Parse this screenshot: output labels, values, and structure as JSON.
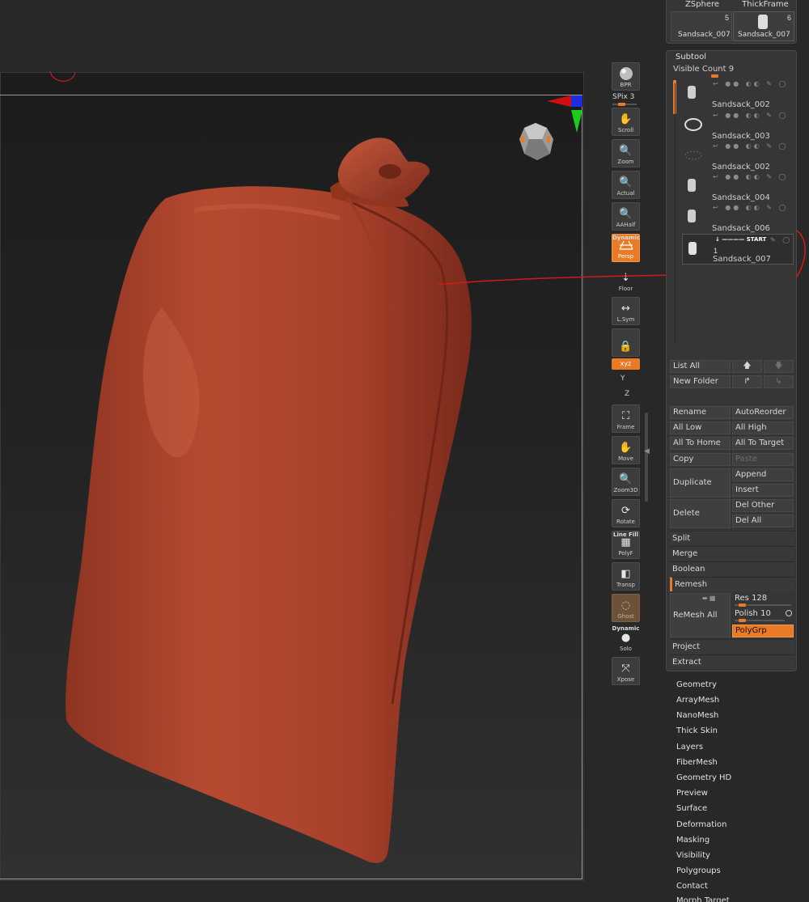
{
  "top_tools": [
    {
      "label": "ZSphere"
    },
    {
      "label": "ThickFrame"
    },
    {
      "label": "Sandsack_007",
      "count": "5"
    },
    {
      "label": "Sandsack_007",
      "count": "6"
    }
  ],
  "shelf": {
    "bpr": "BPR",
    "spix": "SPix 3",
    "buttons": [
      "Scroll",
      "Zoom",
      "Actual",
      "AAHalf",
      "Persp",
      "Floor",
      "L.Sym",
      "",
      "xyz",
      "Frame",
      "Move",
      "Zoom3D",
      "Rotate",
      "PolyF",
      "Transp",
      "Ghost",
      "Solo",
      "Xpose"
    ],
    "persp_tag": "Dynamic",
    "polyf_tag": "Line Fill",
    "solo_tag": "Dynamic",
    "axis_y": "Y",
    "axis_z": "Z"
  },
  "subtool": {
    "title": "Subtool",
    "visible_count_label": "Visible Count",
    "visible_count_value": "9",
    "items": [
      {
        "name": "Sandsack_002"
      },
      {
        "name": "Sandsack_003"
      },
      {
        "name": "Sandsack_002"
      },
      {
        "name": "Sandsack_004"
      },
      {
        "name": "Sandsack_006"
      },
      {
        "name": "Sandsack_007",
        "start": "START",
        "num": "1"
      }
    ],
    "list_all": "List All",
    "new_folder": "New Folder",
    "rename": "Rename",
    "autoreorder": "AutoReorder",
    "all_low": "All Low",
    "all_high": "All High",
    "all_to_home": "All To Home",
    "all_to_target": "All To Target",
    "copy": "Copy",
    "paste": "Paste",
    "duplicate": "Duplicate",
    "append": "Append",
    "insert": "Insert",
    "delete": "Delete",
    "del_other": "Del Other",
    "del_all": "Del All",
    "split": "Split",
    "merge": "Merge",
    "boolean": "Boolean",
    "remesh": "Remesh",
    "remesh_all": "ReMesh All",
    "res_label": "Res",
    "res_value": "128",
    "polish_label": "Polish",
    "polish_value": "10",
    "polygrp": "PolyGrp",
    "project": "Project",
    "extract": "Extract"
  },
  "menus": [
    "Geometry",
    "ArrayMesh",
    "NanoMesh",
    "Thick Skin",
    "Layers",
    "FiberMesh",
    "Geometry HD",
    "Preview",
    "Surface",
    "Deformation",
    "Masking",
    "Visibility",
    "Polygroups",
    "Contact",
    "Morph Target"
  ],
  "colors": {
    "accent": "#e97a26",
    "sack": "#b3452e",
    "annotation": "#d11a1a"
  }
}
